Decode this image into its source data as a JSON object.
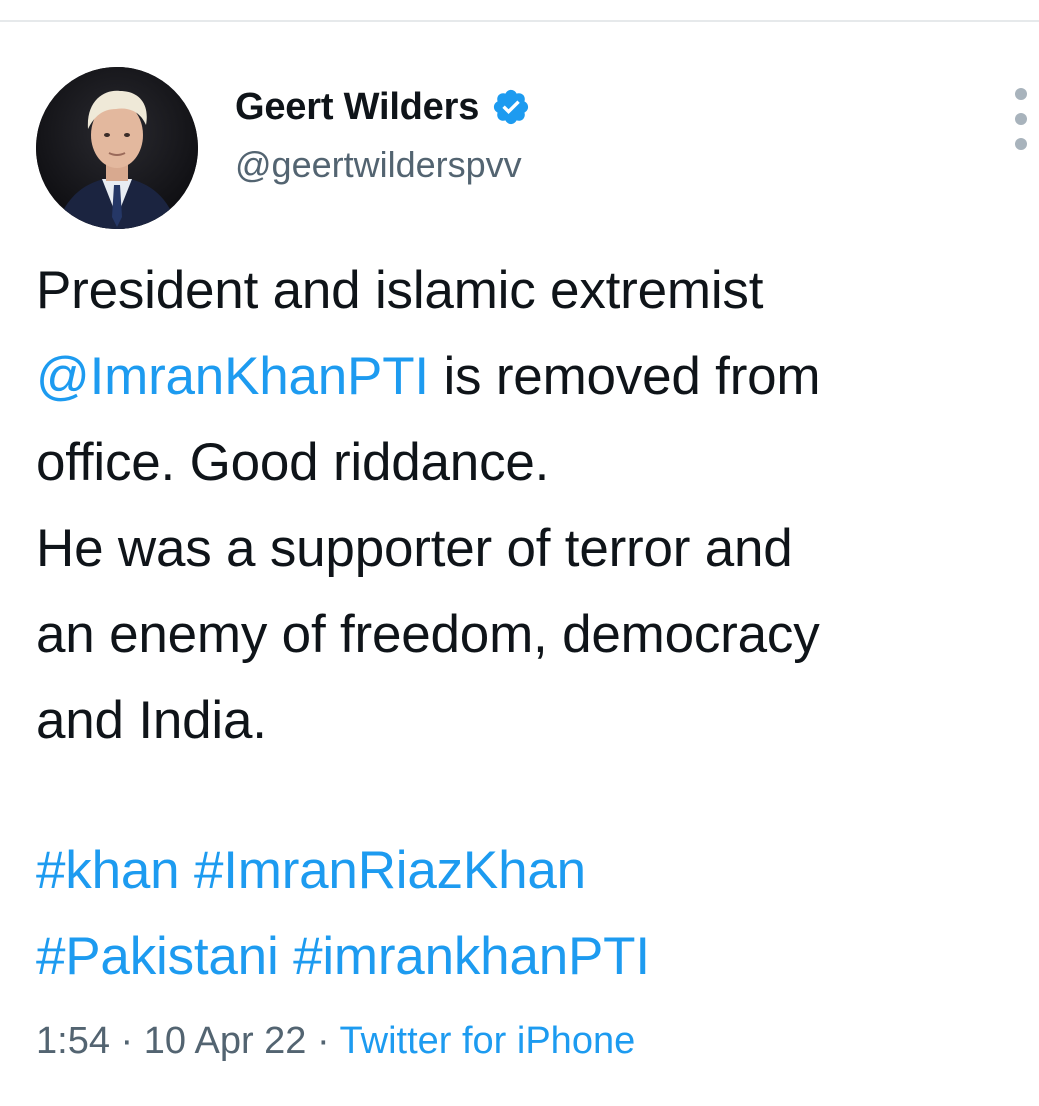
{
  "author": {
    "display_name": "Geert Wilders",
    "handle": "@geertwilderspvv",
    "verified": true,
    "avatar_icon": "profile-photo"
  },
  "tweet": {
    "line1": "President and islamic extremist",
    "mention": "@ImranKhanPTI",
    "line2_rest": " is removed from",
    "line3": "office. Good riddance.",
    "line4": "He was a supporter of terror and",
    "line5": "an enemy of freedom, democracy",
    "line6": "and India.",
    "hashtags_row1": [
      "#khan",
      "#ImranRiazKhan"
    ],
    "hashtags_row2": [
      "#Pakistani",
      "#imrankhanPTI"
    ]
  },
  "meta": {
    "time": "1:54",
    "separator": " · ",
    "date": "10 Apr 22",
    "source": "Twitter for iPhone"
  },
  "colors": {
    "link": "#1d9bf0",
    "text": "#0f1419",
    "secondary": "#536471",
    "more_dots": "#a8b3bc"
  }
}
